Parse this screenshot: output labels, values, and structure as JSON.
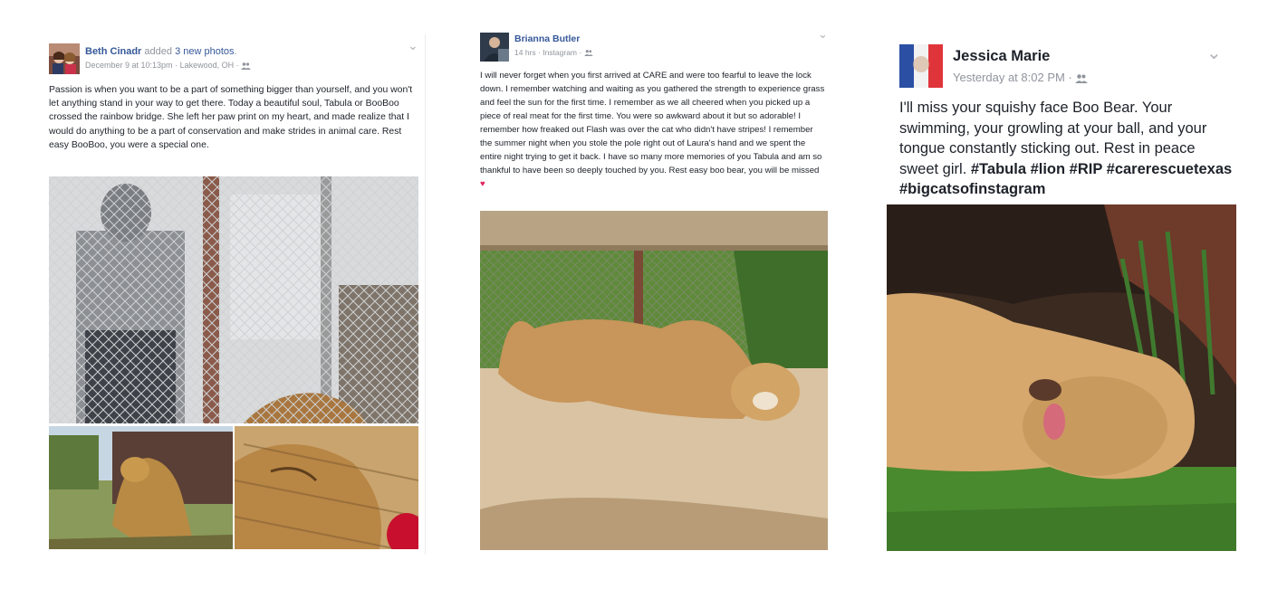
{
  "posts": [
    {
      "author": "Beth Cinadr",
      "action_prefix": "added",
      "action_link": "3 new photos",
      "action_suffix": ".",
      "timestamp": "December 9 at 10:13pm",
      "location": "Lakewood, OH",
      "audience_icon": "friends-icon",
      "text": "Passion is when you want to be a part of something bigger than yourself, and you won't let anything stand in your way to get there. Today a beautiful soul, Tabula or BooBoo crossed the rainbow bridge. She left her paw print on my heart, and made realize that I would do anything to be a part of conservation and make strides in animal care. Rest easy BooBoo, you were a special one."
    },
    {
      "author": "Brianna Butler",
      "timestamp": "14 hrs",
      "source": "Instagram",
      "audience_icon": "friends-icon",
      "text": "I will never forget when you first arrived at CARE and were too fearful to leave the lock down. I remember watching and waiting as you gathered the strength to experience grass and feel the sun for the first time. I remember as we all cheered when you picked up a piece of real meat for the first time. You were so awkward about it but so adorable! I remember how freaked out Flash was over the cat who didn't have stripes! I remember the summer night when you stole the pole right out of Laura's hand and we spent the entire night trying to get it back. I have so many more memories of you Tabula and am so thankful to have been so deeply touched by you. Rest easy boo bear, you will be missed",
      "emoji": "♥"
    },
    {
      "author": "Jessica Marie",
      "timestamp": "Yesterday at 8:02 PM",
      "audience_icon": "friends-icon",
      "text": "I'll miss your squishy face Boo Bear. Your swimming, your growling at your ball, and your tongue constantly sticking out. Rest in peace sweet girl.",
      "hashtags": "#Tabula #lion #RIP #carerescuetexas #bigcatsofinstagram"
    }
  ],
  "separator": "·",
  "chevron": "⌄",
  "colors": {
    "link": "#365899",
    "meta": "#90949c",
    "text": "#1d2129"
  }
}
